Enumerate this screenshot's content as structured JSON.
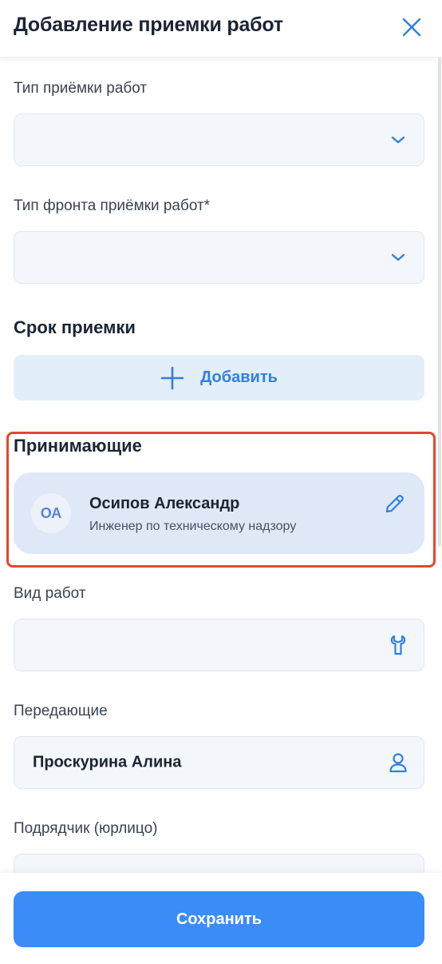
{
  "header": {
    "title": "Добавление приемки работ"
  },
  "fields": {
    "acceptance_type": {
      "label": "Тип приёмки работ",
      "value": ""
    },
    "front_type": {
      "label": "Тип фронта приёмки работ*",
      "value": ""
    }
  },
  "deadline": {
    "title": "Срок приемки",
    "add_label": "Добавить"
  },
  "receivers": {
    "title": "Принимающие",
    "person": {
      "initials": "ОА",
      "name": "Осипов Александр",
      "role": "Инженер по техническому надзору"
    }
  },
  "work_type": {
    "label": "Вид работ",
    "value": ""
  },
  "transferring": {
    "label": "Передающие",
    "value": "Проскурина Алина"
  },
  "contractor": {
    "label": "Подрядчик (юрлицо)",
    "value": ""
  },
  "footer": {
    "save_label": "Сохранить"
  },
  "colors": {
    "accent": "#3a8cf7",
    "highlight": "#e8452c",
    "card": "#dee8f7",
    "input_bg": "#f3f7fb"
  },
  "icons": [
    "close-icon",
    "chevron-down-icon",
    "plus-icon",
    "edit-pencil-icon",
    "wrench-icon",
    "user-icon"
  ]
}
